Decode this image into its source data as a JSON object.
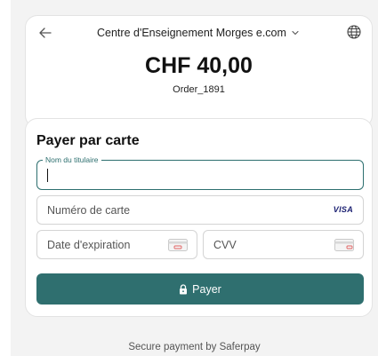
{
  "header": {
    "merchant_name": "Centre d'Enseignement Morges e.com",
    "amount": "CHF 40,00",
    "order_id": "Order_1891"
  },
  "form": {
    "title": "Payer par carte",
    "holder_label": "Nom du titulaire",
    "holder_value": "",
    "card_number_placeholder": "Numéro de carte",
    "card_brand": "VISA",
    "expiry_placeholder": "Date d'expiration",
    "cvv_placeholder": "CVV",
    "pay_label": "Payer"
  },
  "footer": {
    "text": "Secure payment by Saferpay"
  },
  "icons": {
    "back": "arrow-left-icon",
    "language": "globe-icon",
    "lock": "lock-icon"
  },
  "colors": {
    "accent": "#2f6f6f",
    "visa": "#1a1f71"
  }
}
